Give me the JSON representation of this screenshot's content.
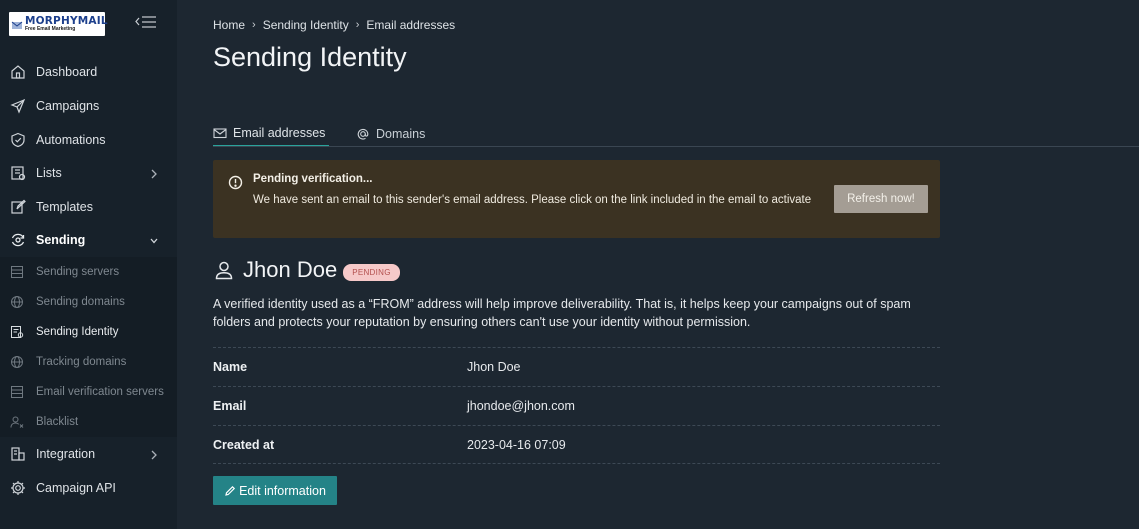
{
  "brand": {
    "name": "MORPHYMAIL",
    "tagline": "Free Email Marketing"
  },
  "sidebar": {
    "items": [
      {
        "label": "Dashboard",
        "icon": "home-icon"
      },
      {
        "label": "Campaigns",
        "icon": "send-icon"
      },
      {
        "label": "Automations",
        "icon": "shield-check-icon"
      },
      {
        "label": "Lists",
        "icon": "list-icon",
        "has_submenu": true
      },
      {
        "label": "Templates",
        "icon": "edit-icon"
      },
      {
        "label": "Sending",
        "icon": "sending-icon",
        "expanded": true
      },
      {
        "label": "Integration",
        "icon": "integration-icon",
        "has_submenu": true
      },
      {
        "label": "Campaign API",
        "icon": "gear-icon"
      }
    ],
    "sending_sub": [
      {
        "label": "Sending servers",
        "icon": "server-icon"
      },
      {
        "label": "Sending domains",
        "icon": "globe-icon"
      },
      {
        "label": "Sending Identity",
        "icon": "identity-icon",
        "active": true
      },
      {
        "label": "Tracking domains",
        "icon": "globe-icon"
      },
      {
        "label": "Email verification servers",
        "icon": "server-icon"
      },
      {
        "label": "Blacklist",
        "icon": "user-x-icon"
      }
    ]
  },
  "breadcrumb": [
    "Home",
    "Sending Identity",
    "Email addresses"
  ],
  "page_title": "Sending Identity",
  "tabs": [
    {
      "label": "Email addresses",
      "icon": "mail-icon",
      "active": true
    },
    {
      "label": "Domains",
      "icon": "at-icon"
    }
  ],
  "alert": {
    "title": "Pending verification...",
    "message": "We have sent an email to this sender's email address. Please click on the link included in the email to activate",
    "button": "Refresh now!"
  },
  "identity": {
    "name": "Jhon Doe",
    "status": "PENDING",
    "description": "A verified identity used as a “FROM” address will help improve deliverability. That is, it helps keep your campaigns out of spam folders and protects your reputation by ensuring others can't use your identity without permission."
  },
  "details": [
    {
      "key": "Name",
      "value": "Jhon Doe"
    },
    {
      "key": "Email",
      "value": "jhondoe@jhon.com"
    },
    {
      "key": "Created at",
      "value": "2023-04-16 07:09"
    }
  ],
  "edit_button": "Edit information",
  "colors": {
    "background": "#1d2731",
    "sidebar": "#17212a",
    "accent": "#2aa39b",
    "alert_bg": "#3b3222",
    "badge_bg": "#f6c9c9",
    "primary_button": "#248387"
  }
}
